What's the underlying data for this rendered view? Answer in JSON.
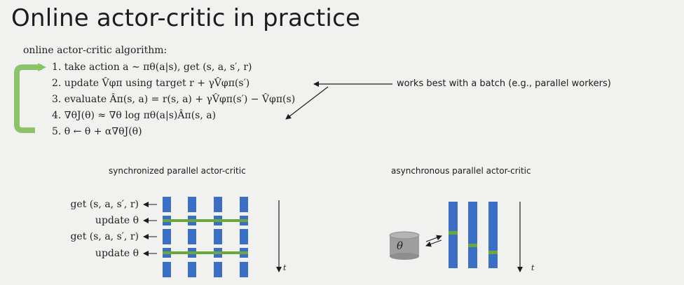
{
  "title": "Online actor-critic in practice",
  "algorithm": {
    "heading": "online actor-critic algorithm:",
    "steps": [
      "1. take action a ∼ πθ(a|s), get (s, a, s′, r)",
      "2. update V̂φπ using target r + γV̂φπ(s′)",
      "3. evaluate Âπ(s, a) = r(s, a) + γV̂φπ(s′) − V̂φπ(s)",
      "4. ∇θJ(θ) ≈ ∇θ log πθ(a|s)Âπ(s, a)",
      "5. θ ← θ + α∇θJ(θ)"
    ]
  },
  "annotation": "works best with a batch (e.g., parallel workers)",
  "sync": {
    "label": "synchronized parallel actor-critic",
    "rows": [
      "get (s, a, s′, r)",
      "update θ",
      "get (s, a, s′, r)",
      "update θ"
    ],
    "time_label": "t"
  },
  "async": {
    "label": "asynchronous parallel actor-critic",
    "param_label": "θ",
    "time_label": "t"
  },
  "colors": {
    "worker_bar": "#3b6fc6",
    "update_line": "#6aa83a",
    "loop_arrow": "#8cc26a",
    "param_store": "#9e9e9e"
  }
}
